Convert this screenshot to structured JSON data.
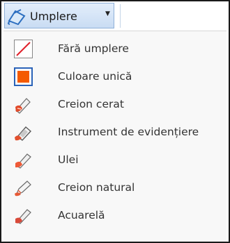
{
  "toolbar": {
    "fill_button_label": "Umplere",
    "fill_icon": "paint-bucket-icon",
    "caret_icon": "dropdown-caret-icon"
  },
  "colors": {
    "selected_fill": "#f45a00",
    "selected_border": "#2a62b8",
    "no_fill_slash": "#e0202a"
  },
  "menu": {
    "items": [
      {
        "label": "Fără umplere",
        "icon": "no-fill-icon"
      },
      {
        "label": "Culoare unică",
        "icon": "solid-color-icon",
        "selected": true
      },
      {
        "label": "Creion cerat",
        "icon": "crayon-icon"
      },
      {
        "label": "Instrument de evidențiere",
        "icon": "marker-icon"
      },
      {
        "label": "Ulei",
        "icon": "oil-brush-icon"
      },
      {
        "label": "Creion natural",
        "icon": "natural-pencil-icon"
      },
      {
        "label": "Acuarelă",
        "icon": "watercolor-icon"
      }
    ]
  }
}
